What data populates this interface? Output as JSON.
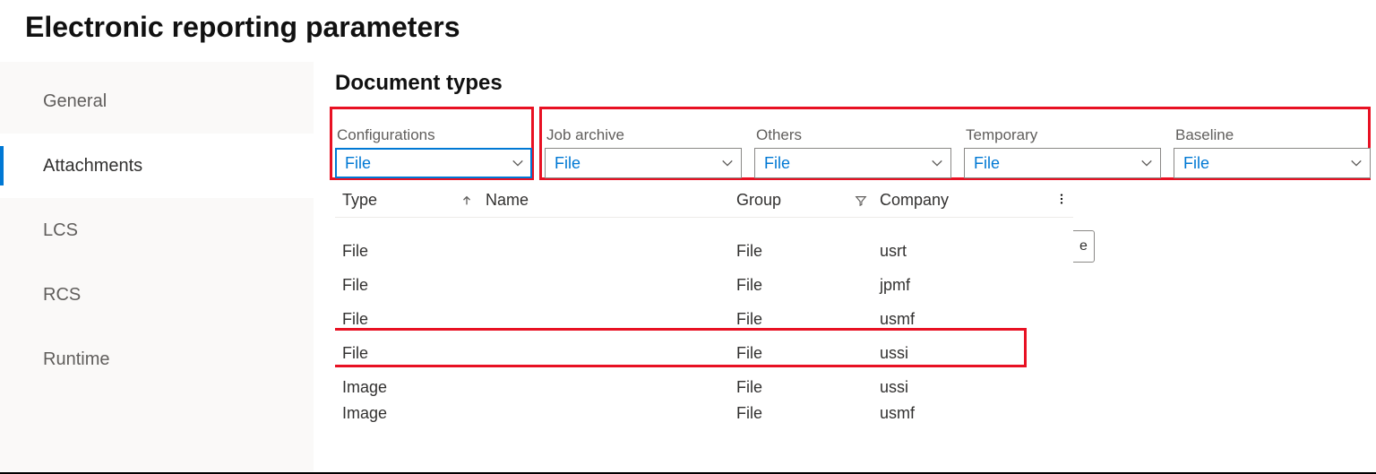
{
  "page": {
    "title": "Electronic reporting parameters"
  },
  "sidebar": {
    "items": [
      {
        "label": "General"
      },
      {
        "label": "Attachments"
      },
      {
        "label": "LCS"
      },
      {
        "label": "RCS"
      },
      {
        "label": "Runtime"
      }
    ],
    "active_index": 1
  },
  "section": {
    "title": "Document types"
  },
  "fields": [
    {
      "label": "Configurations",
      "value": "File"
    },
    {
      "label": "Job archive",
      "value": "File"
    },
    {
      "label": "Others",
      "value": "File"
    },
    {
      "label": "Temporary",
      "value": "File"
    },
    {
      "label": "Baseline",
      "value": "File"
    }
  ],
  "grid": {
    "columns": [
      {
        "label": "Type"
      },
      {
        "label": "Name"
      },
      {
        "label": "Group"
      },
      {
        "label": "Company"
      }
    ],
    "rows": [
      {
        "type": "File",
        "name": "",
        "group": "File",
        "company": "usrt"
      },
      {
        "type": "File",
        "name": "",
        "group": "File",
        "company": "jpmf"
      },
      {
        "type": "File",
        "name": "",
        "group": "File",
        "company": "usmf"
      },
      {
        "type": "File",
        "name": "",
        "group": "File",
        "company": "ussi"
      },
      {
        "type": "Image",
        "name": "",
        "group": "File",
        "company": "ussi"
      },
      {
        "type": "Image",
        "name": "",
        "group": "File",
        "company": "usmf"
      }
    ],
    "highlight_row_index": 2,
    "stray_button_glyph": "e"
  }
}
